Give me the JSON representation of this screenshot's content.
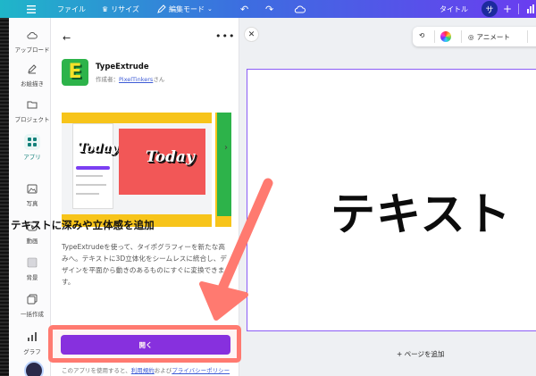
{
  "topbar": {
    "menu_icon": "hamburger-icon",
    "file_label": "ファイル",
    "resize_label": "リサイズ",
    "edit_mode_label": "編集モード",
    "title_label": "タイトル",
    "avatar_initial": "サ",
    "plus_label": "+"
  },
  "rail": {
    "items": [
      {
        "label": "アップロード",
        "icon": "upload-cloud-icon"
      },
      {
        "label": "お絵描き",
        "icon": "pen-icon"
      },
      {
        "label": "プロジェクト",
        "icon": "folder-icon"
      },
      {
        "label": "アプリ",
        "icon": "apps-grid-icon"
      },
      {
        "label": "写真",
        "icon": "image-icon"
      },
      {
        "label": "動画",
        "icon": "play-icon"
      },
      {
        "label": "背景",
        "icon": "background-icon"
      },
      {
        "label": "一括作成",
        "icon": "bulk-create-icon"
      },
      {
        "label": "グラフ",
        "icon": "chart-icon"
      }
    ]
  },
  "panel": {
    "app_name": "TypeExtrude",
    "creator_prefix": "作成者：",
    "creator_name": "PixelTinkers",
    "creator_suffix": "さん",
    "preview_word": "Today",
    "headline": "テキストに深みや立体感を追加",
    "description": "TypeExtrudeを使って、タイポグラフィーを新たな高みへ。テキストに3D立体化をシームレスに統合し、デザインを平面から動きのあるものにすぐに変換できます。",
    "open_button": "開く",
    "terms_prefix": "このアプリを使用すると、",
    "terms_link1": "利用規約",
    "terms_middle": "および",
    "terms_link2": "プライバシーポリシー"
  },
  "toolbar": {
    "animate_label": "アニメート"
  },
  "canvas": {
    "text": "テキスト",
    "add_page_label": "+ ページを追加"
  },
  "colors": {
    "accent": "#7d2ae8",
    "annotation": "#ff7a70",
    "teal": "#12807a"
  }
}
